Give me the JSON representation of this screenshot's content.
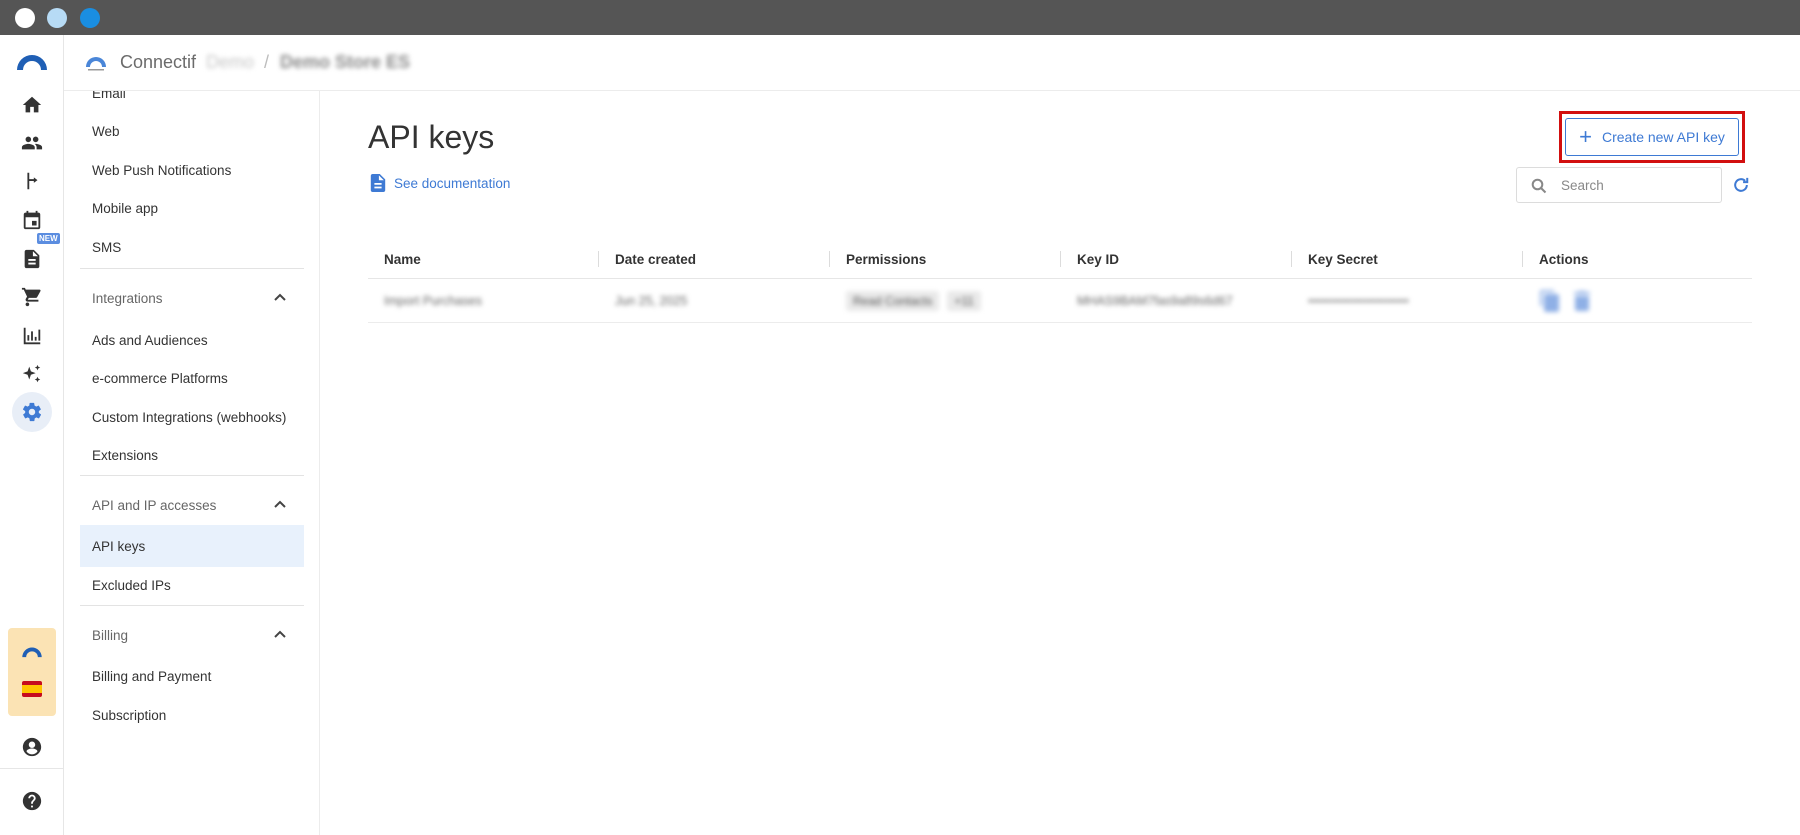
{
  "header": {
    "brand": "Connectif",
    "account": "Demo",
    "separator": "/",
    "store": "Demo Store ES"
  },
  "rail": {
    "new_badge": "NEW",
    "icons": [
      "home-icon",
      "contacts-icon",
      "workflows-icon",
      "calendar-icon",
      "content-icon",
      "cart-icon",
      "reports-icon",
      "ai-sparkle-icon",
      "settings-icon"
    ],
    "account_flag": "spain-flag"
  },
  "sidebar": {
    "channels": [
      "Email",
      "Web",
      "Web Push Notifications",
      "Mobile app",
      "SMS"
    ],
    "sections": [
      {
        "title": "Integrations",
        "items": [
          "Ads and Audiences",
          "e-commerce Platforms",
          "Custom Integrations (webhooks)",
          "Extensions"
        ]
      },
      {
        "title": "API and IP accesses",
        "items": [
          "API keys",
          "Excluded IPs"
        ]
      },
      {
        "title": "Billing",
        "items": [
          "Billing and Payment",
          "Subscription"
        ]
      }
    ],
    "active_item": "API keys"
  },
  "main": {
    "title": "API keys",
    "doc_link": "See documentation",
    "create_button": "Create new API key",
    "search_placeholder": "Search",
    "table": {
      "columns": [
        "Name",
        "Date created",
        "Permissions",
        "Key ID",
        "Key Secret",
        "Actions"
      ],
      "rows": [
        {
          "name": "Import Purchases",
          "date": "Jun 25, 2025",
          "permissions": [
            "Read Contacts",
            "+11"
          ],
          "key_id": "MHAS9BAM7fas9a89s6d67",
          "key_secret": "••••••••••••••••••••••••"
        }
      ]
    }
  },
  "colors": {
    "accent": "#3e7ad4",
    "highlight": "#d20f0f",
    "active_bg": "#e8f1fc",
    "titlebar": "#555555"
  }
}
